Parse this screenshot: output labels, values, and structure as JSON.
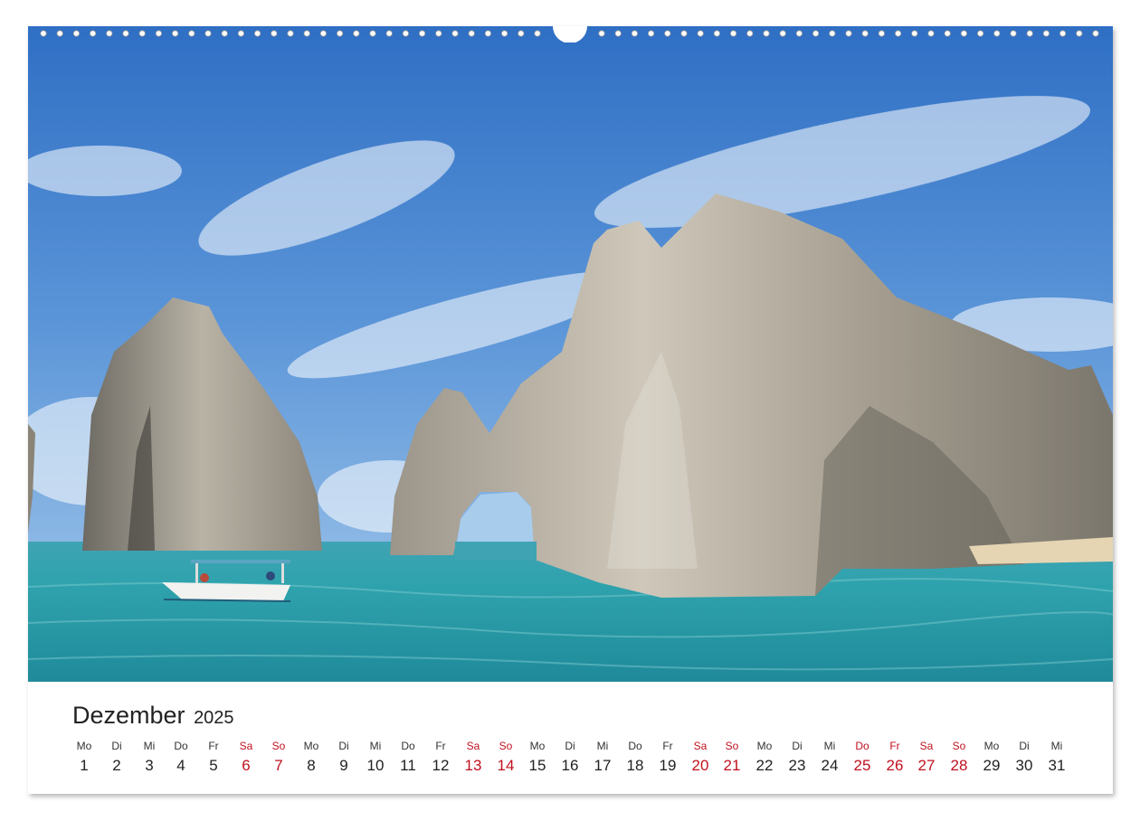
{
  "calendar": {
    "month": "Dezember",
    "year": "2025",
    "holiday_color": "#c0111f",
    "days": [
      {
        "wd": "Mo",
        "num": "1",
        "hol": false
      },
      {
        "wd": "Di",
        "num": "2",
        "hol": false
      },
      {
        "wd": "Mi",
        "num": "3",
        "hol": false
      },
      {
        "wd": "Do",
        "num": "4",
        "hol": false
      },
      {
        "wd": "Fr",
        "num": "5",
        "hol": false
      },
      {
        "wd": "Sa",
        "num": "6",
        "hol": true
      },
      {
        "wd": "So",
        "num": "7",
        "hol": true
      },
      {
        "wd": "Mo",
        "num": "8",
        "hol": false
      },
      {
        "wd": "Di",
        "num": "9",
        "hol": false
      },
      {
        "wd": "Mi",
        "num": "10",
        "hol": false
      },
      {
        "wd": "Do",
        "num": "11",
        "hol": false
      },
      {
        "wd": "Fr",
        "num": "12",
        "hol": false
      },
      {
        "wd": "Sa",
        "num": "13",
        "hol": true
      },
      {
        "wd": "So",
        "num": "14",
        "hol": true
      },
      {
        "wd": "Mo",
        "num": "15",
        "hol": false
      },
      {
        "wd": "Di",
        "num": "16",
        "hol": false
      },
      {
        "wd": "Mi",
        "num": "17",
        "hol": false
      },
      {
        "wd": "Do",
        "num": "18",
        "hol": false
      },
      {
        "wd": "Fr",
        "num": "19",
        "hol": false
      },
      {
        "wd": "Sa",
        "num": "20",
        "hol": true
      },
      {
        "wd": "So",
        "num": "21",
        "hol": true
      },
      {
        "wd": "Mo",
        "num": "22",
        "hol": false
      },
      {
        "wd": "Di",
        "num": "23",
        "hol": false
      },
      {
        "wd": "Mi",
        "num": "24",
        "hol": false
      },
      {
        "wd": "Do",
        "num": "25",
        "hol": true
      },
      {
        "wd": "Fr",
        "num": "26",
        "hol": true
      },
      {
        "wd": "Sa",
        "num": "27",
        "hol": true
      },
      {
        "wd": "So",
        "num": "28",
        "hol": true
      },
      {
        "wd": "Mo",
        "num": "29",
        "hol": false
      },
      {
        "wd": "Di",
        "num": "30",
        "hol": false
      },
      {
        "wd": "Mi",
        "num": "31",
        "hol": false
      }
    ]
  }
}
